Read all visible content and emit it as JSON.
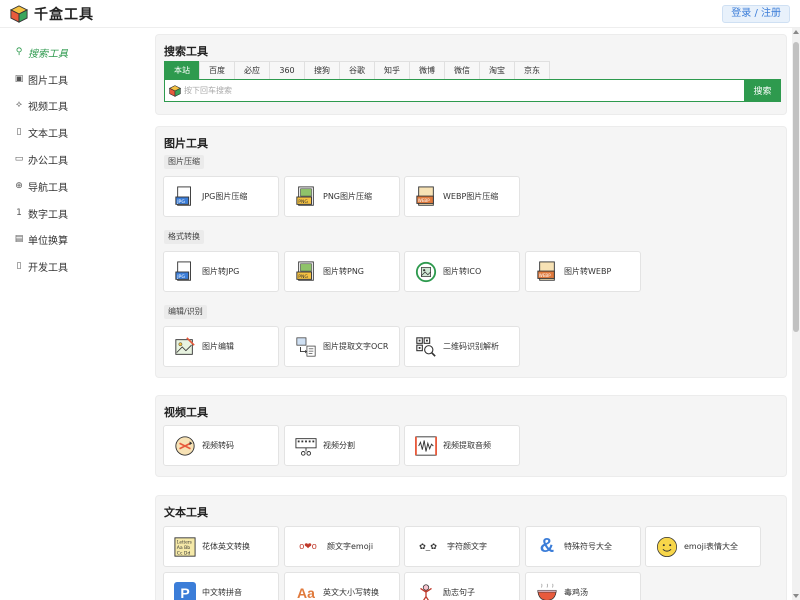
{
  "header": {
    "logo_text": "千盒工具",
    "login_label": "登录 / 注册"
  },
  "sidebar": {
    "items": [
      {
        "label": "搜索工具",
        "icon": "search-icon",
        "active": true
      },
      {
        "label": "图片工具",
        "icon": "image-icon"
      },
      {
        "label": "视频工具",
        "icon": "video-icon"
      },
      {
        "label": "文本工具",
        "icon": "text-icon"
      },
      {
        "label": "办公工具",
        "icon": "folder-icon"
      },
      {
        "label": "导航工具",
        "icon": "globe-icon"
      },
      {
        "label": "数字工具",
        "icon": "number-icon"
      },
      {
        "label": "单位换算",
        "icon": "ruler-icon"
      },
      {
        "label": "开发工具",
        "icon": "code-icon"
      }
    ]
  },
  "search": {
    "title": "搜索工具",
    "tabs": [
      "本站",
      "百度",
      "必应",
      "360",
      "搜狗",
      "谷歌",
      "知乎",
      "微博",
      "微信",
      "淘宝",
      "京东"
    ],
    "placeholder": "按下回车搜索",
    "button_label": "搜索"
  },
  "image_tools": {
    "title": "图片工具",
    "groups": [
      {
        "label": "图片压缩",
        "items": [
          {
            "label": "JPG图片压缩",
            "icon": "jpg-file-icon"
          },
          {
            "label": "PNG图片压缩",
            "icon": "png-file-icon"
          },
          {
            "label": "WEBP图片压缩",
            "icon": "webp-file-icon"
          }
        ]
      },
      {
        "label": "格式转换",
        "items": [
          {
            "label": "图片转JPG",
            "icon": "jpg-file-icon"
          },
          {
            "label": "图片转PNG",
            "icon": "png-file-icon"
          },
          {
            "label": "图片转ICO",
            "icon": "ico-convert-icon"
          },
          {
            "label": "图片转WEBP",
            "icon": "webp-file-icon"
          }
        ]
      },
      {
        "label": "编辑/识别",
        "items": [
          {
            "label": "图片编辑",
            "icon": "image-edit-icon"
          },
          {
            "label": "图片提取文字OCR",
            "icon": "ocr-icon"
          },
          {
            "label": "二维码识别解析",
            "icon": "qrcode-scan-icon"
          }
        ]
      }
    ]
  },
  "video_tools": {
    "title": "视频工具",
    "items": [
      {
        "label": "视频转码",
        "icon": "video-transcode-icon"
      },
      {
        "label": "视频分割",
        "icon": "video-split-icon"
      },
      {
        "label": "视频提取音频",
        "icon": "audio-extract-icon"
      }
    ]
  },
  "text_tools": {
    "title": "文本工具",
    "items": [
      {
        "label": "花体英文转换",
        "icon": "fancy-letters-icon"
      },
      {
        "label": "颜文字emoji",
        "icon": "kaomoji-icon",
        "glyph": "o❤o"
      },
      {
        "label": "字符颜文字",
        "icon": "char-kaomoji-icon",
        "glyph": "✿_✿"
      },
      {
        "label": "特殊符号大全",
        "icon": "ampersand-icon",
        "glyph": "&"
      },
      {
        "label": "emoji表情大全",
        "icon": "smiley-icon"
      },
      {
        "label": "中文转拼音",
        "icon": "pinyin-icon",
        "glyph": "P"
      },
      {
        "label": "英文大小写转换",
        "icon": "case-convert-icon",
        "glyph": "Aa"
      },
      {
        "label": "励志句子",
        "icon": "motivation-icon"
      },
      {
        "label": "毒鸡汤",
        "icon": "soup-bowl-icon"
      }
    ]
  },
  "colors": {
    "accent": "#2e9a4e",
    "panel_bg": "#f5f5f5"
  }
}
